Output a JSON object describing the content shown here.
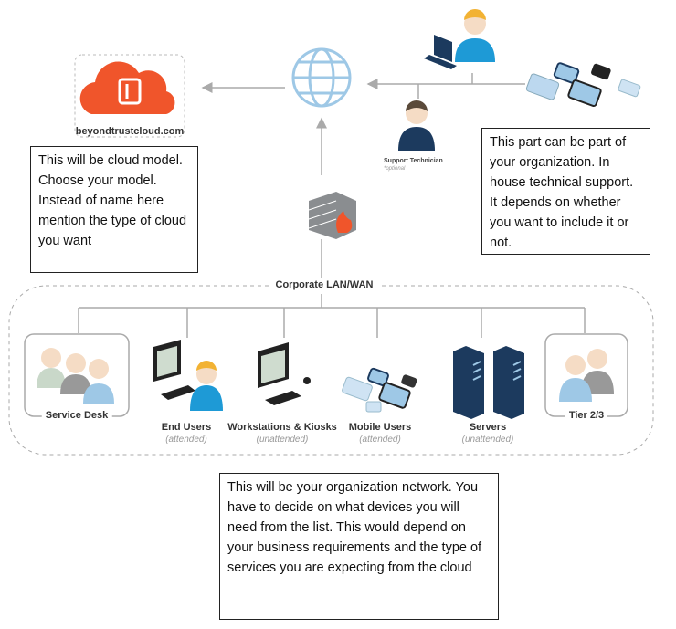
{
  "cloud": {
    "domain": "beyondtrustcloud.com",
    "brand_color": "#f0552b"
  },
  "support": {
    "label": "Support Technician",
    "note": "*optional"
  },
  "notes": {
    "cloud": "This will be cloud model. Choose your model. Instead of name here mention the type of cloud you want",
    "inhouse": "This part can be part of your organization. In house technical support. It depends on whether you want to include it or not.",
    "network": "This will be your organization network. You have to decide on what devices you will need from the list. This would depend on your business requirements and the type of services you are expecting from the cloud"
  },
  "lan": {
    "label": "Corporate LAN/WAN"
  },
  "nodes": [
    {
      "label": "Service Desk",
      "sub": ""
    },
    {
      "label": "End Users",
      "sub": "(attended)"
    },
    {
      "label": "Workstations & Kiosks",
      "sub": "(unattended)"
    },
    {
      "label": "Mobile Users",
      "sub": "(attended)"
    },
    {
      "label": "Servers",
      "sub": "(unattended)"
    },
    {
      "label": "Tier 2/3",
      "sub": ""
    }
  ]
}
